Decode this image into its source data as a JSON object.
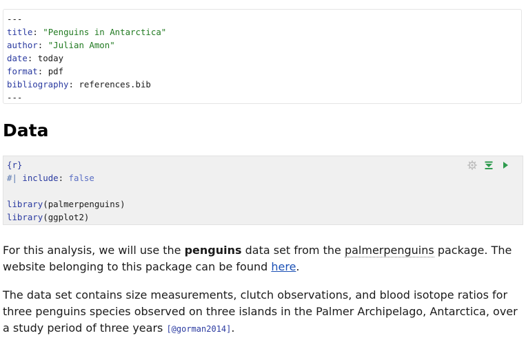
{
  "yaml": {
    "open_fence": "---",
    "title_key": "title",
    "title_value": "\"Penguins in Antarctica\"",
    "author_key": "author",
    "author_value": "\"Julian Amon\"",
    "date_key": "date",
    "date_value": "today",
    "format_key": "format",
    "format_value": "pdf",
    "bibliography_key": "bibliography",
    "bibliography_value": "references.bib",
    "close_fence": "---"
  },
  "heading": "Data",
  "chunk": {
    "header": "{r}",
    "option_prefix": "#|",
    "option_key": "include",
    "option_value": "false",
    "line1_fn": "library",
    "line1_arg": "palmerpenguins",
    "line2_fn": "library",
    "line2_arg": "ggplot2",
    "tools": {
      "settings_icon": "gear-icon",
      "run_above_icon": "run-previous-chunks-icon",
      "run_icon": "run-chunk-icon",
      "accent_color": "#2e9b4e"
    }
  },
  "paragraph1": {
    "part1": "For this analysis, we will use the ",
    "bold": "penguins",
    "part2": " data set from the ",
    "package": "palmerpenguins",
    "part3": " package. The website belonging to this package can be found ",
    "link": "here",
    "part4": "."
  },
  "paragraph2": {
    "text": "The data set contains size measurements, clutch observations, and blood isotope ratios for three penguins species observed on three islands in the Palmer Archipelago, Antarctica, over a study period of three years ",
    "citation": "[@gorman2014]",
    "end": "."
  }
}
